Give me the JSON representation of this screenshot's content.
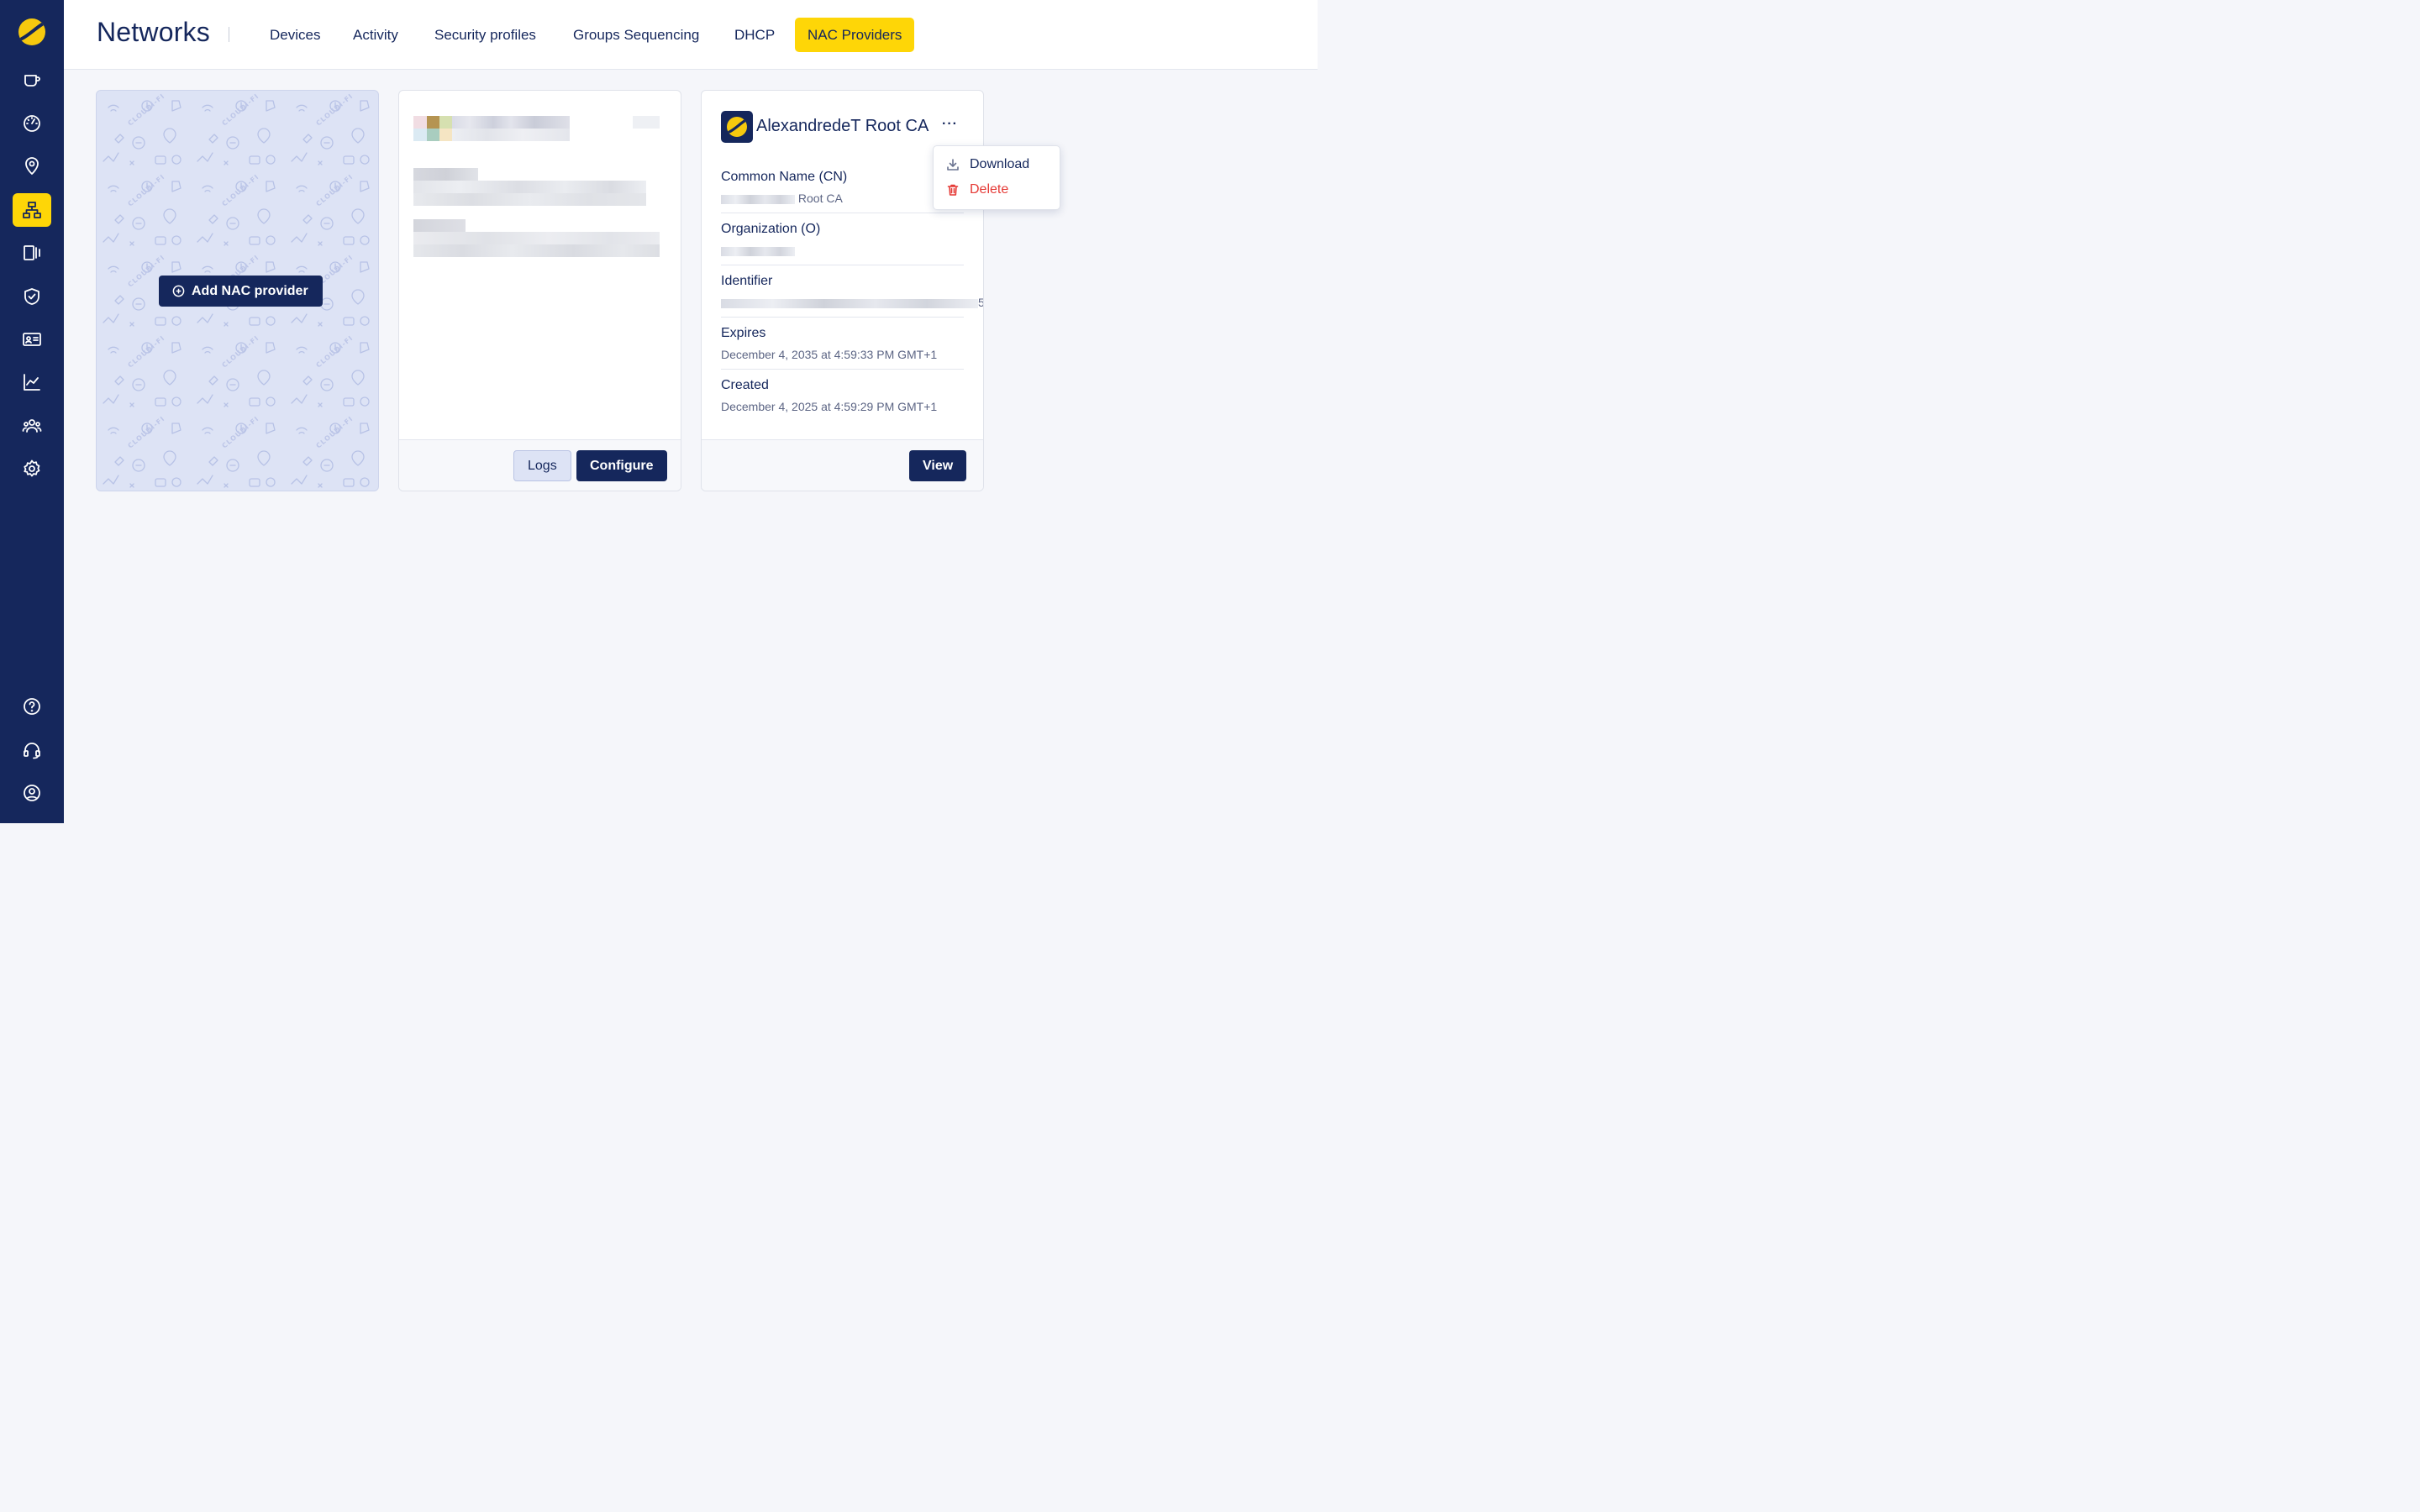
{
  "sidebar": {
    "logo": "cloudi-fi-logo",
    "items": [
      {
        "name": "coffee-icon",
        "active": false
      },
      {
        "name": "dashboard-icon",
        "active": false
      },
      {
        "name": "location-icon",
        "active": false
      },
      {
        "name": "network-icon",
        "active": true
      },
      {
        "name": "devices-icon",
        "active": false
      },
      {
        "name": "shield-icon",
        "active": false
      },
      {
        "name": "id-card-icon",
        "active": false
      },
      {
        "name": "analytics-icon",
        "active": false
      },
      {
        "name": "users-icon",
        "active": false
      },
      {
        "name": "settings-icon",
        "active": false
      }
    ],
    "bottom_items": [
      {
        "name": "help-icon"
      },
      {
        "name": "support-icon"
      },
      {
        "name": "account-icon"
      }
    ]
  },
  "header": {
    "title": "Networks",
    "tabs": [
      {
        "label": "Devices",
        "active": false
      },
      {
        "label": "Activity",
        "active": false
      },
      {
        "label": "Security profiles",
        "active": false
      },
      {
        "label": "Groups Sequencing",
        "active": false
      },
      {
        "label": "DHCP",
        "active": false
      },
      {
        "label": "NAC Providers",
        "active": true
      }
    ]
  },
  "add_card": {
    "button_label": "Add NAC provider",
    "pattern_text": "CLOUDI-FI"
  },
  "provider_card": {
    "logs_label": "Logs",
    "configure_label": "Configure"
  },
  "ca_card": {
    "title": "AlexandredeT Root CA",
    "more_label": "···",
    "fields": [
      {
        "label": "Common Name (CN)",
        "value": "Root CA"
      },
      {
        "label": "Organization (O)",
        "value": ""
      },
      {
        "label": "Identifier",
        "value": "5"
      },
      {
        "label": "Expires",
        "value": "December 4, 2035 at 4:59:33 PM GMT+1"
      },
      {
        "label": "Created",
        "value": "December 4, 2025 at 4:59:29 PM GMT+1"
      }
    ],
    "view_label": "View"
  },
  "menu": {
    "download_label": "Download",
    "delete_label": "Delete"
  },
  "colors": {
    "navy": "#15275c",
    "yellow": "#fed607",
    "danger": "#e53935",
    "pattern_bg": "#dde3f5"
  }
}
